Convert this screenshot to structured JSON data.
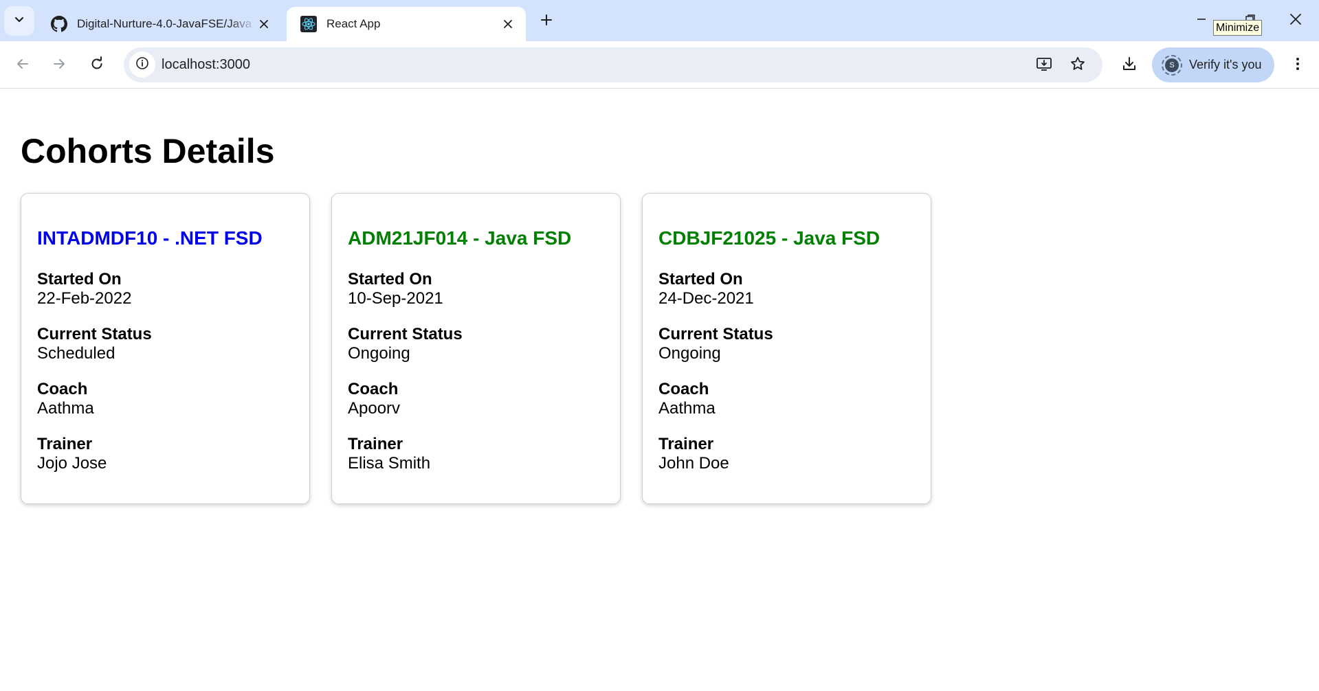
{
  "browser": {
    "tabs": [
      {
        "title": "Digital-Nurture-4.0-JavaFSE/Java",
        "favicon": "github-icon",
        "active": false
      },
      {
        "title": "React App",
        "favicon": "react-icon",
        "active": true
      }
    ],
    "tooltip": "Minimize",
    "address": "localhost:3000",
    "profile_label": "Verify it's you",
    "profile_initial": "S"
  },
  "page": {
    "title": "Cohorts Details"
  },
  "cohorts": [
    {
      "name": "INTADMDF10 - .NET FSD",
      "title_color": "#0000ee",
      "started_on_label": "Started On",
      "started_on": "22-Feb-2022",
      "status_label": "Current Status",
      "status": "Scheduled",
      "coach_label": "Coach",
      "coach": "Aathma",
      "trainer_label": "Trainer",
      "trainer": "Jojo Jose"
    },
    {
      "name": "ADM21JF014 - Java FSD",
      "title_color": "#008000",
      "started_on_label": "Started On",
      "started_on": "10-Sep-2021",
      "status_label": "Current Status",
      "status": "Ongoing",
      "coach_label": "Coach",
      "coach": "Apoorv",
      "trainer_label": "Trainer",
      "trainer": "Elisa Smith"
    },
    {
      "name": "CDBJF21025 - Java FSD",
      "title_color": "#008000",
      "started_on_label": "Started On",
      "started_on": "24-Dec-2021",
      "status_label": "Current Status",
      "status": "Ongoing",
      "coach_label": "Coach",
      "coach": "Aathma",
      "trainer_label": "Trainer",
      "trainer": "John Doe"
    }
  ]
}
